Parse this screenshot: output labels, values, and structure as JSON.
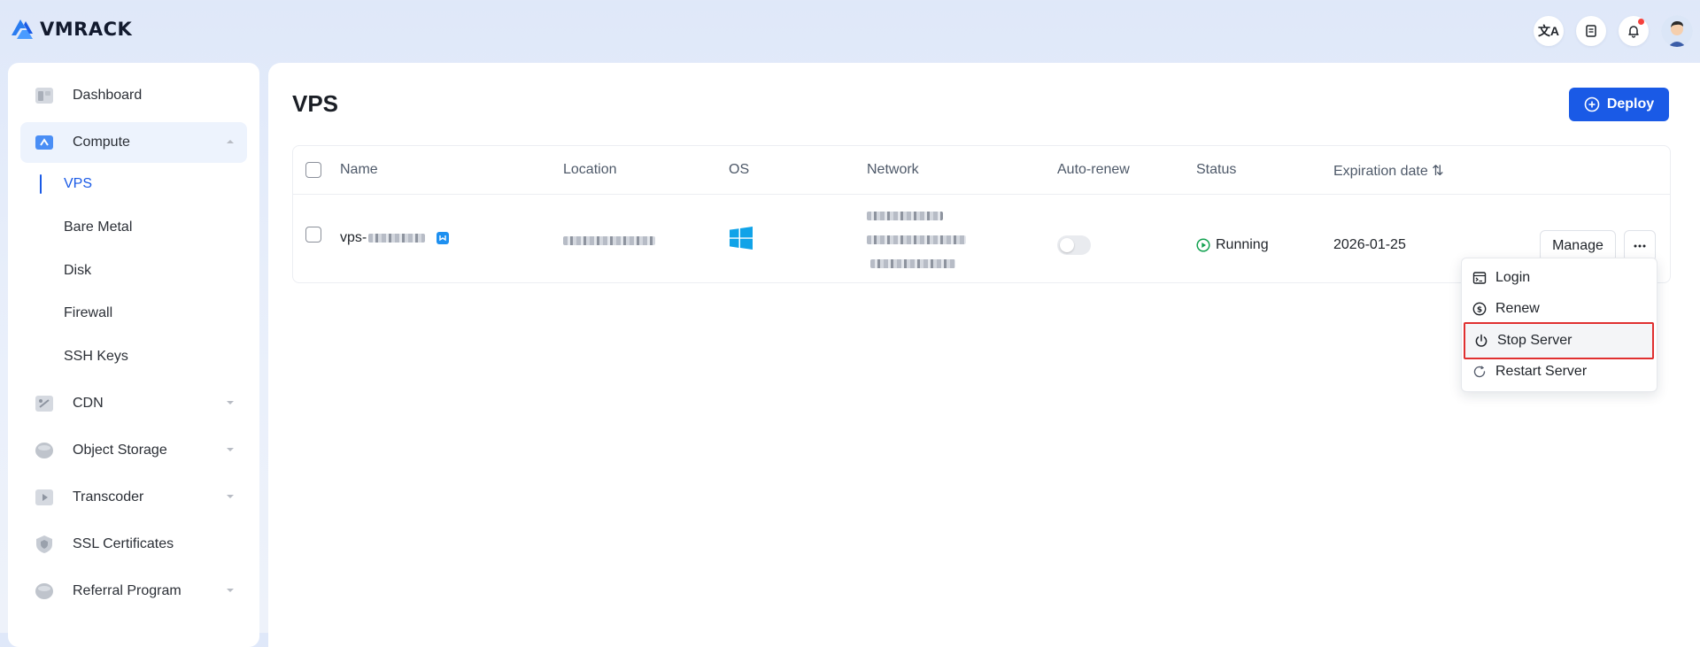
{
  "app": {
    "brand": "VMRACK"
  },
  "header": {
    "icons": [
      "translate-icon",
      "document-icon",
      "bell-icon",
      "avatar"
    ]
  },
  "sidebar": {
    "items": [
      {
        "label": "Dashboard"
      },
      {
        "label": "Compute"
      },
      {
        "label": "CDN"
      },
      {
        "label": "Object Storage"
      },
      {
        "label": "Transcoder"
      },
      {
        "label": "SSL Certificates"
      },
      {
        "label": "Referral Program"
      }
    ],
    "compute_sub": [
      {
        "label": "VPS"
      },
      {
        "label": "Bare Metal"
      },
      {
        "label": "Disk"
      },
      {
        "label": "Firewall"
      },
      {
        "label": "SSH Keys"
      }
    ]
  },
  "main": {
    "title": "VPS",
    "deploy_label": "Deploy",
    "table": {
      "columns": [
        "Name",
        "Location",
        "OS",
        "Network",
        "Auto-renew",
        "Status",
        "Expiration date ⇅"
      ],
      "rows": [
        {
          "name": "vps-",
          "status": "Running",
          "expiration": "2026-01-25",
          "auto_renew": false,
          "manage_label": "Manage"
        }
      ]
    }
  },
  "menu": {
    "items": [
      {
        "label": "Login"
      },
      {
        "label": "Renew"
      },
      {
        "label": "Stop Server"
      },
      {
        "label": "Restart Server"
      }
    ]
  },
  "colors": {
    "accent": "#1a5ae6",
    "running": "#12a150",
    "highlight": "#e03030"
  }
}
